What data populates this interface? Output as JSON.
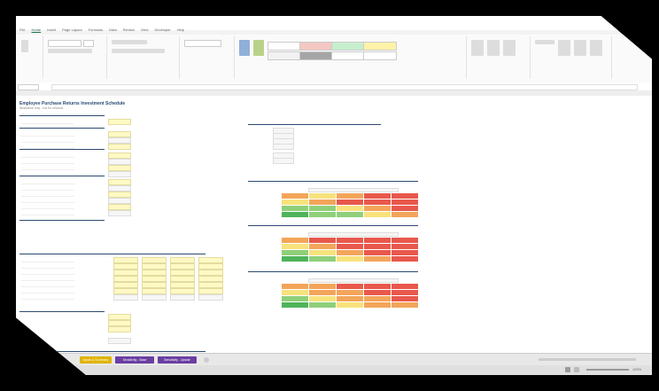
{
  "app": {
    "name": "Excel"
  },
  "menu": {
    "items": [
      "File",
      "Home",
      "Insert",
      "Page Layout",
      "Formulas",
      "Data",
      "Review",
      "View",
      "Developer",
      "Help"
    ]
  },
  "sheet": {
    "title": "Employee Purchase Returns Investment Schedule",
    "subtitle": "Illustrative only - not for reliance"
  },
  "tabs": [
    {
      "label": "Inputs & Summary",
      "color": "#e0b400"
    },
    {
      "label": "Sensitivity - Base",
      "color": "#6a3ea1"
    },
    {
      "label": "Sensitivity - Upside",
      "color": "#6a3ea1"
    }
  ],
  "status": {
    "zoom": "100%"
  },
  "heat_colors": {
    "red": "#e8584c",
    "orange": "#f3a55a",
    "yellow": "#f7e27c",
    "green": "#8fcf7a",
    "dkgreen": "#4fb35a"
  }
}
